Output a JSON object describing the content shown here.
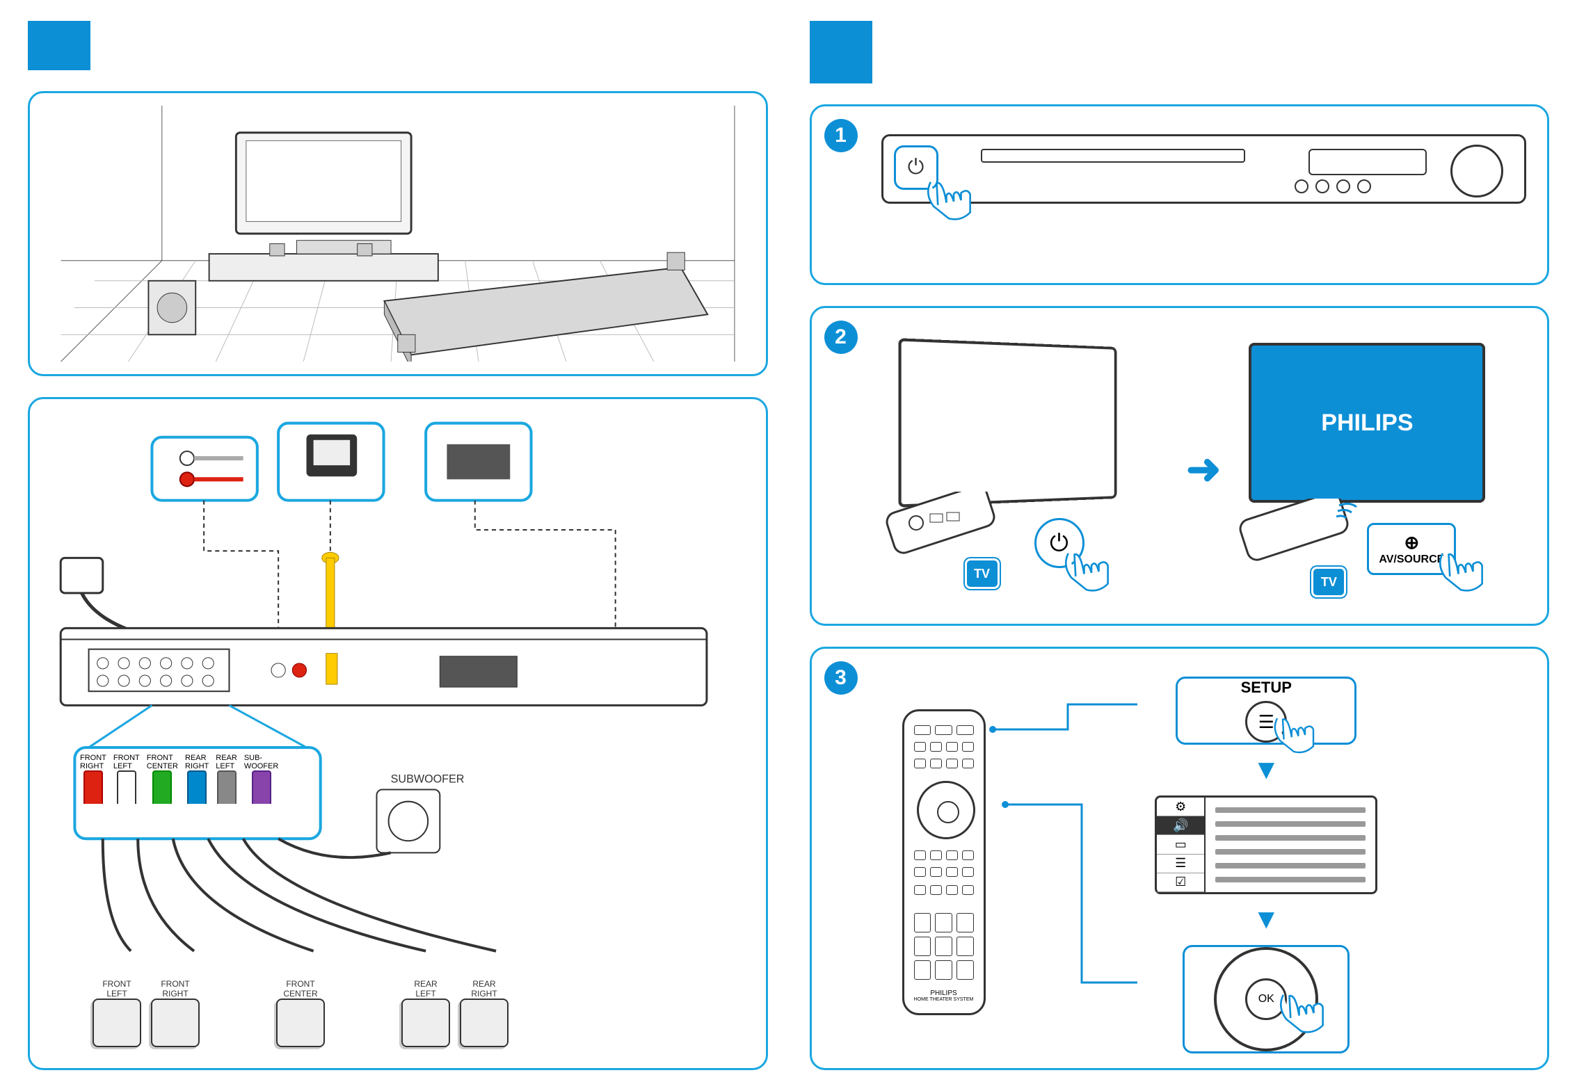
{
  "left": {
    "section_marker": "",
    "speaker_terminals": [
      {
        "label": "FRONT\nRIGHT",
        "color": "red"
      },
      {
        "label": "FRONT\nLEFT",
        "color": "white"
      },
      {
        "label": "FRONT\nCENTER",
        "color": "green"
      },
      {
        "label": "REAR\nRIGHT",
        "color": "blue"
      },
      {
        "label": "REAR\nLEFT",
        "color": "grey"
      },
      {
        "label": "SUB-\nWOOFER",
        "color": "purple"
      }
    ],
    "subwoofer_label": "SUBWOOFER",
    "speaker_boxes": [
      "FRONT\nLEFT",
      "FRONT\nRIGHT",
      "FRONT\nCENTER",
      "REAR\nLEFT",
      "REAR\nRIGHT"
    ]
  },
  "right": {
    "step1_num": "1",
    "step2_num": "2",
    "step3_num": "3",
    "tv_brand": "PHILIPS",
    "tv_badge": "TV",
    "avsource": "AV/SOURCE",
    "setup": "SETUP",
    "ok": "OK",
    "remote_brand": "PHILIPS",
    "remote_subtitle": "HOME THEATER SYSTEM"
  }
}
